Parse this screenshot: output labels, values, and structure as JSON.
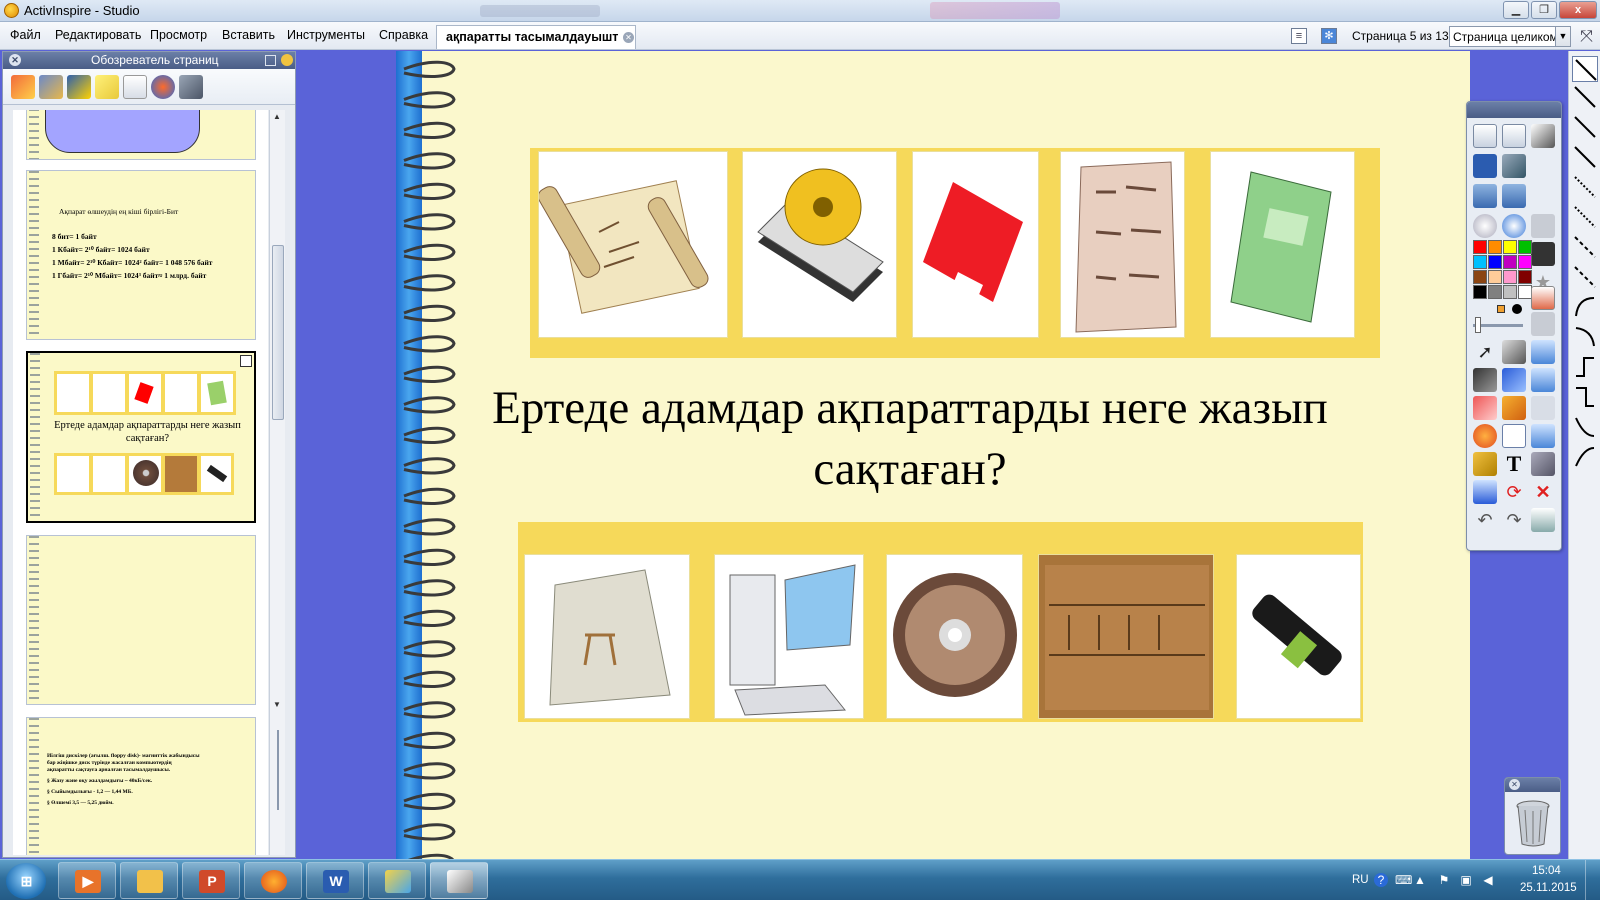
{
  "window": {
    "title": "ActivInspire - Studio",
    "min_icon": "minimize-icon",
    "max_icon": "maximize-icon",
    "close_label": "x"
  },
  "menu": {
    "items": [
      "Файл",
      "Редактировать",
      "Просмотр",
      "Вставить",
      "Инструменты",
      "Справка"
    ],
    "doc_tab": "ақпаратты тасымалдауышт",
    "page_info": "Страница 5 из 13",
    "view_mode": "Страница целиком"
  },
  "browser": {
    "title": "Обозреватель страниц",
    "thumb2": {
      "line1_prefix": "Ақпарат өлшеудің ең кіші бірлігі-",
      "line1_accent": "Бит",
      "lines": [
        "8 бит= 1 байт",
        "1 Кбайт= 2¹⁰ байт= 1024 байт",
        "1 Мбайт= 2¹⁰ Кбайт= 1024² байт= 1 048 576 байт",
        "1 Гбайт= 2¹⁰ Мбайт= 1024³ байт≈ 1 млрд. байт"
      ]
    },
    "thumb3": {
      "question": "Ертеде адамдар ақпараттарды неге жазып сақтаған?"
    },
    "thumb5": {
      "lines": [
        "Иілгіш дискілер (ағылш. floppy disk)- магниттік жабындысы",
        "бар жіңішке диск түрінде жасалған компьютердің",
        "ақпаратты сақтауға арналған тасымалдаушысы.",
        "§  Жазу және оқу жылдамдығы ~ 40кБ/сек.",
        "§  Сыйымдылығы - 1,2 — 1,44 МБ.",
        "§  Өлшемі 3,5 — 5,25 дюйм."
      ]
    }
  },
  "canvas": {
    "question": "Ертеде адамдар ақпараттарды неге жазып сақтаған?",
    "top_images": [
      "scroll-image",
      "hard-drive-image",
      "floppy-disk-image",
      "clay-tablet-image",
      "book-image"
    ],
    "bottom_images": [
      "cave-drawing-image",
      "computer-image",
      "cd-image",
      "papyrus-image",
      "usb-flash-image"
    ]
  },
  "colors": {
    "canvas_bg": "#fbf8cd",
    "strip": "#f6d95a",
    "desktop": "#5a63d8",
    "palette": [
      "#ff0000",
      "#ff8c00",
      "#ffff00",
      "#00c000",
      "#00c0ff",
      "#0000ff",
      "#c000c0",
      "#ff00ff",
      "#8b4513",
      "#ffcc99",
      "#ff99cc",
      "#800000",
      "#000000",
      "#808080",
      "#c0c0c0",
      "#ffffff"
    ]
  },
  "taskbar": {
    "lang": "RU",
    "time": "15:04",
    "date": "25.11.2015"
  }
}
